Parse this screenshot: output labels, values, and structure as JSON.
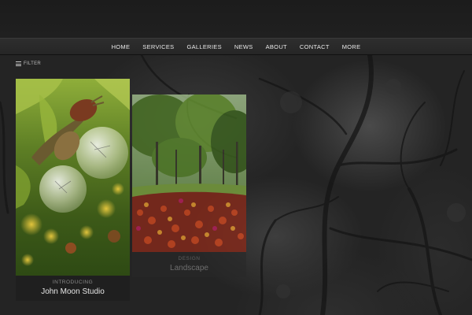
{
  "navigation": {
    "items": [
      "HOME",
      "SERVICES",
      "GALLERIES",
      "NEWS",
      "ABOUT",
      "CONTACT",
      "MORE"
    ]
  },
  "filter": {
    "label": "FILTER",
    "icon": "menu-icon"
  },
  "portfolio": {
    "items": [
      {
        "category": "INTRODUCING",
        "title": "John Moon Studio",
        "image": "snail on light bulbs"
      },
      {
        "category": "DESIGN",
        "title": "Landscape",
        "image": "tulip garden landscape"
      }
    ]
  },
  "colors": {
    "background": "#242424",
    "nav_background": "#2a2a2a",
    "nav_text": "#e8e8e8"
  }
}
